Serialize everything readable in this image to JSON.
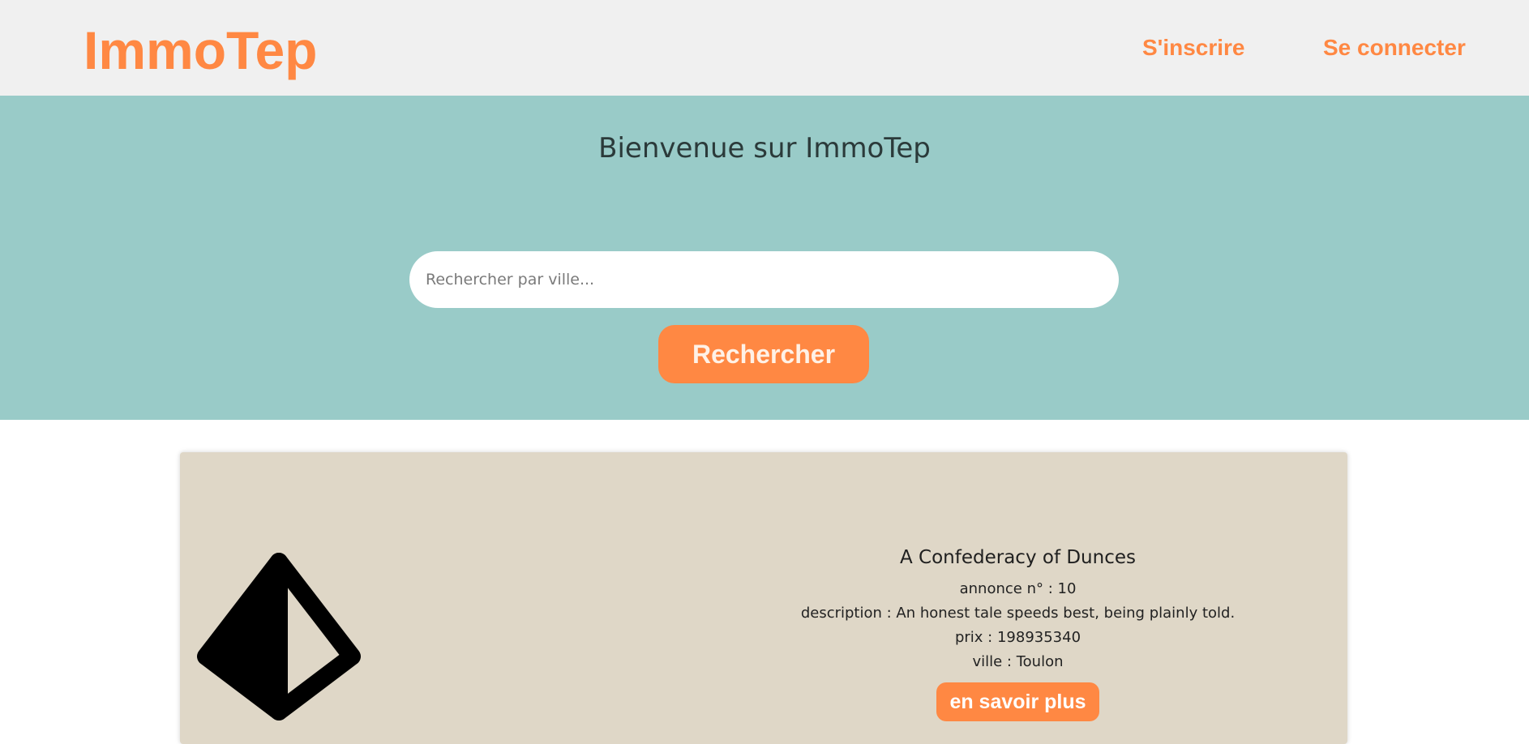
{
  "header": {
    "logo": "ImmoTep",
    "nav": {
      "signup_label": "S'inscrire",
      "login_label": "Se connecter"
    }
  },
  "hero": {
    "title": "Bienvenue sur ImmoTep",
    "search": {
      "placeholder": "Rechercher par ville...",
      "value": "",
      "button_label": "Rechercher"
    }
  },
  "listings": [
    {
      "image_icon": "pyramid-icon",
      "title": "A Confederacy of Dunces",
      "annonce": "annonce n° : 10",
      "description": "description : An honest tale speeds best, being plainly told.",
      "prix": "prix : 198935340",
      "ville": "ville : Toulon",
      "button_label": "en savoir plus"
    }
  ],
  "colors": {
    "accent": "#ff8843",
    "header_bg": "#f0f0f0",
    "hero_bg": "#99cbc8",
    "card_bg": "#dfd7c7"
  }
}
